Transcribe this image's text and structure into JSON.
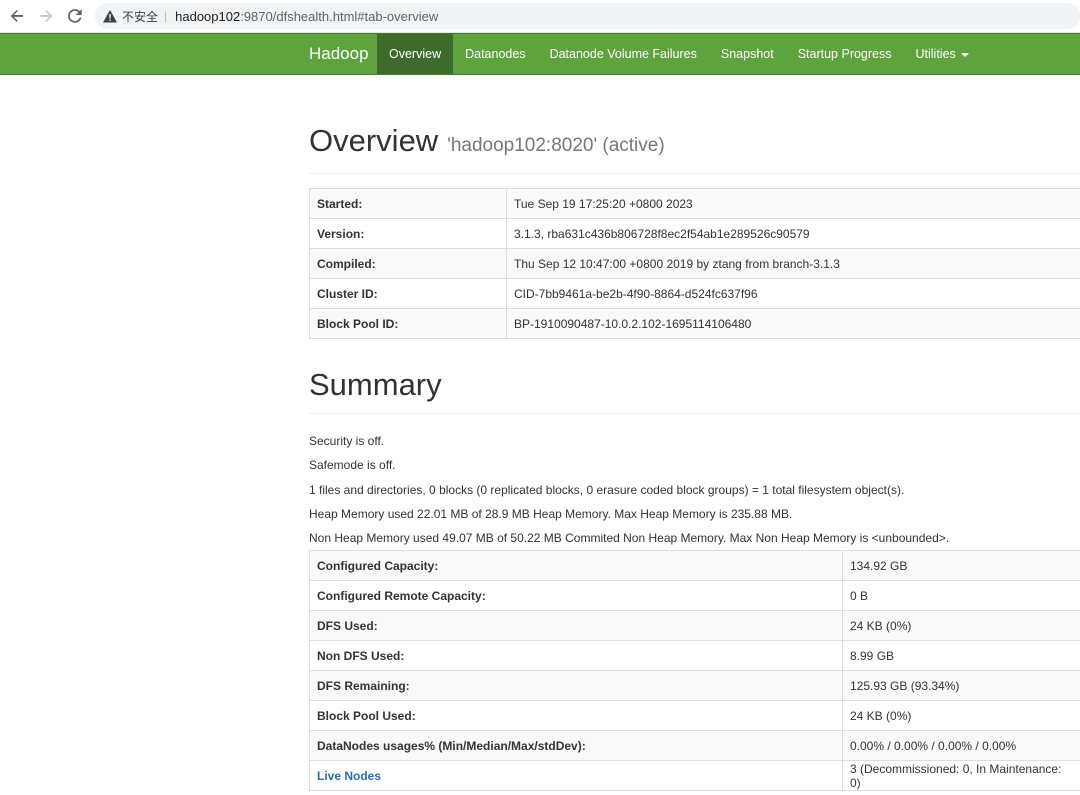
{
  "browser": {
    "security_label": "不安全",
    "url_host": "hadoop102",
    "url_rest": ":9870/dfshealth.html#tab-overview"
  },
  "navbar": {
    "brand": "Hadoop",
    "items": [
      {
        "label": "Overview",
        "active": true
      },
      {
        "label": "Datanodes"
      },
      {
        "label": "Datanode Volume Failures"
      },
      {
        "label": "Snapshot"
      },
      {
        "label": "Startup Progress"
      },
      {
        "label": "Utilities"
      }
    ],
    "bg_color": "#5fa33e",
    "active_color": "#3c6b2b"
  },
  "overview": {
    "title": "Overview",
    "subtitle": "'hadoop102:8020' (active)",
    "rows": [
      {
        "key": "Started:",
        "value": "Tue Sep 19 17:25:20 +0800 2023"
      },
      {
        "key": "Version:",
        "value": "3.1.3, rba631c436b806728f8ec2f54ab1e289526c90579"
      },
      {
        "key": "Compiled:",
        "value": "Thu Sep 12 10:47:00 +0800 2019 by ztang from branch-3.1.3"
      },
      {
        "key": "Cluster ID:",
        "value": "CID-7bb9461a-be2b-4f90-8864-d524fc637f96"
      },
      {
        "key": "Block Pool ID:",
        "value": "BP-1910090487-10.0.2.102-1695114106480"
      }
    ]
  },
  "summary": {
    "title": "Summary",
    "lines": [
      "Security is off.",
      "Safemode is off.",
      "1 files and directories, 0 blocks (0 replicated blocks, 0 erasure coded block groups) = 1 total filesystem object(s).",
      "Heap Memory used 22.01 MB of 28.9 MB Heap Memory. Max Heap Memory is 235.88 MB.",
      "Non Heap Memory used 49.07 MB of 50.22 MB Commited Non Heap Memory. Max Non Heap Memory is <unbounded>."
    ],
    "rows": [
      {
        "key": "Configured Capacity:",
        "value": "134.92 GB"
      },
      {
        "key": "Configured Remote Capacity:",
        "value": "0 B"
      },
      {
        "key": "DFS Used:",
        "value": "24 KB (0%)"
      },
      {
        "key": "Non DFS Used:",
        "value": "8.99 GB"
      },
      {
        "key": "DFS Remaining:",
        "value": "125.93 GB (93.34%)"
      },
      {
        "key": "Block Pool Used:",
        "value": "24 KB (0%)"
      },
      {
        "key": "DataNodes usages% (Min/Median/Max/stdDev):",
        "value": "0.00% / 0.00% / 0.00% / 0.00%"
      },
      {
        "key": "Live Nodes",
        "value": "3 (Decommissioned: 0, In Maintenance: 0)"
      }
    ]
  }
}
